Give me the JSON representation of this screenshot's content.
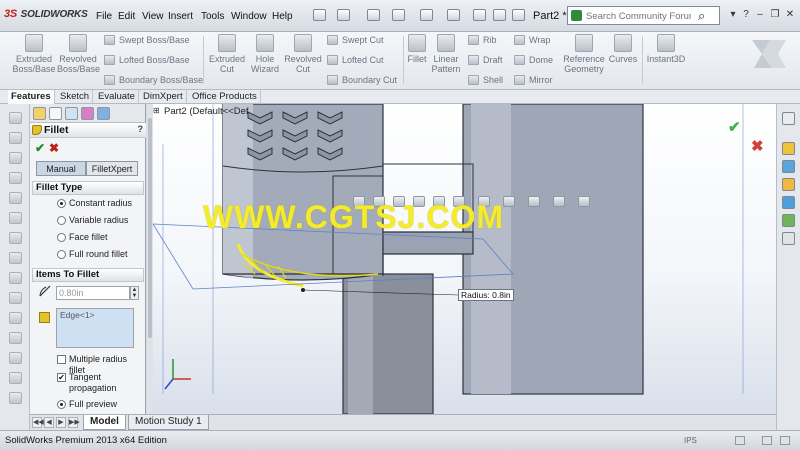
{
  "app": {
    "logo_prefix": "3S",
    "logo_text": "SOLIDWORKS",
    "doc_title": "Part2 *"
  },
  "menu": [
    "File",
    "Edit",
    "View",
    "Insert",
    "Tools",
    "Window",
    "Help"
  ],
  "search": {
    "placeholder": "Search Community Forum",
    "value": "Search Community Forum"
  },
  "ribbon": {
    "extruded_boss": "Extruded Boss/Base",
    "revolved_boss": "Revolved Boss/Base",
    "swept_boss": "Swept Boss/Base",
    "lofted_boss": "Lofted Boss/Base",
    "boundary_boss": "Boundary Boss/Base",
    "extruded_cut": "Extruded Cut",
    "hole_wizard": "Hole Wizard",
    "revolved_cut": "Revolved Cut",
    "swept_cut": "Swept Cut",
    "lofted_cut": "Lofted Cut",
    "boundary_cut": "Boundary Cut",
    "fillet": "Fillet",
    "linear_pattern": "Linear Pattern",
    "rib": "Rib",
    "draft": "Draft",
    "shell": "Shell",
    "wrap": "Wrap",
    "dome": "Dome",
    "mirror": "Mirror",
    "reference_geometry": "Reference Geometry",
    "curves": "Curves",
    "instant3d": "Instant3D"
  },
  "cm_tabs": [
    "Features",
    "Sketch",
    "Evaluate",
    "DimXpert",
    "Office Products"
  ],
  "property_manager": {
    "title": "Fillet",
    "help": "?",
    "tabs": [
      "Manual",
      "FilletXpert"
    ],
    "fillet_type": {
      "heading": "Fillet Type",
      "options": [
        "Constant radius",
        "Variable radius",
        "Face fillet",
        "Full round fillet"
      ],
      "selected": "Constant radius"
    },
    "items": {
      "heading": "Items To Fillet",
      "radius_value": "0.80in",
      "edge_item": "Edge<1>"
    },
    "multiple_radius": "Multiple radius fillet",
    "tangent_propagation": "Tangent propagation",
    "full_preview": "Full preview"
  },
  "viewport": {
    "tree_root": "Part2  (Default<<Def",
    "radius_callout": "Radius: 0.8in",
    "watermark": "WWW.CGTSJ.COM"
  },
  "bottom_tabs": [
    "Model",
    "Motion Study 1"
  ],
  "status": {
    "text": "SolidWorks Premium 2013 x64 Edition",
    "ips": "IPS"
  },
  "colors": {
    "accent_green": "#1d8a2a",
    "accent_red": "#c0201a",
    "selection_yellow": "#f4ec2b",
    "edge_list_blue": "#cfe0f2"
  }
}
